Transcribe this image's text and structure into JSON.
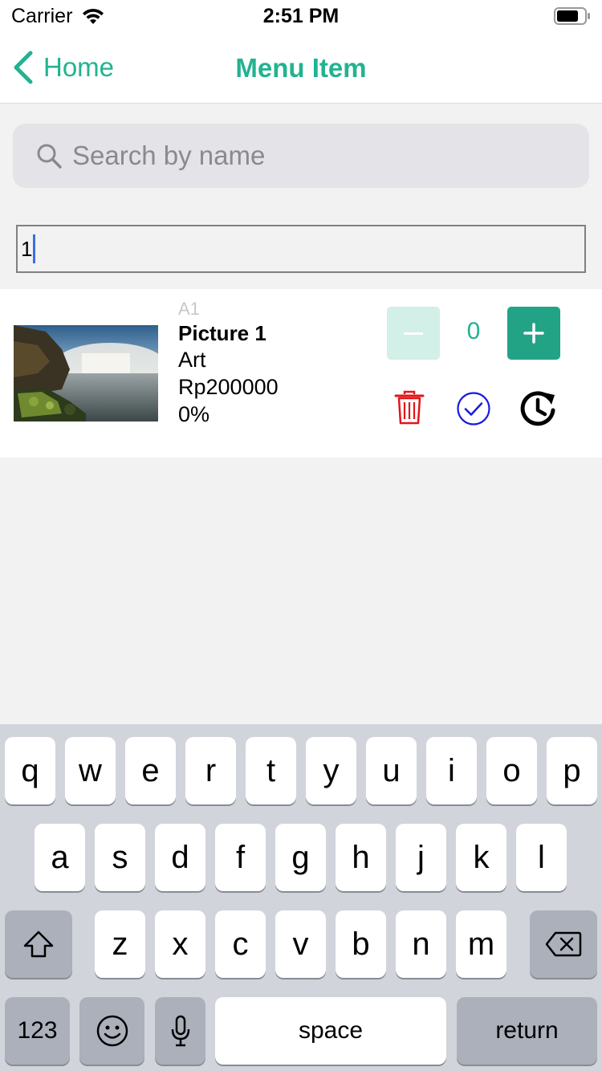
{
  "status_bar": {
    "carrier": "Carrier",
    "time": "2:51 PM"
  },
  "nav": {
    "back_label": "Home",
    "title": "Menu Item"
  },
  "search": {
    "placeholder": "Search by name"
  },
  "text_field": {
    "value": "1"
  },
  "item": {
    "code": "A1",
    "name": "Picture 1",
    "category": "Art",
    "price": "Rp200000",
    "discount": "0%",
    "quantity": "0"
  },
  "keyboard": {
    "row1": [
      "q",
      "w",
      "e",
      "r",
      "t",
      "y",
      "u",
      "i",
      "o",
      "p"
    ],
    "row2": [
      "a",
      "s",
      "d",
      "f",
      "g",
      "h",
      "j",
      "k",
      "l"
    ],
    "row3": [
      "z",
      "x",
      "c",
      "v",
      "b",
      "n",
      "m"
    ],
    "numbers_label": "123",
    "space_label": "space",
    "return_label": "return"
  },
  "colors": {
    "accent": "#22b391",
    "accent_dark": "#22a386",
    "accent_light": "#d2efe8",
    "delete": "#e3151a",
    "confirm": "#1a1ae0"
  }
}
